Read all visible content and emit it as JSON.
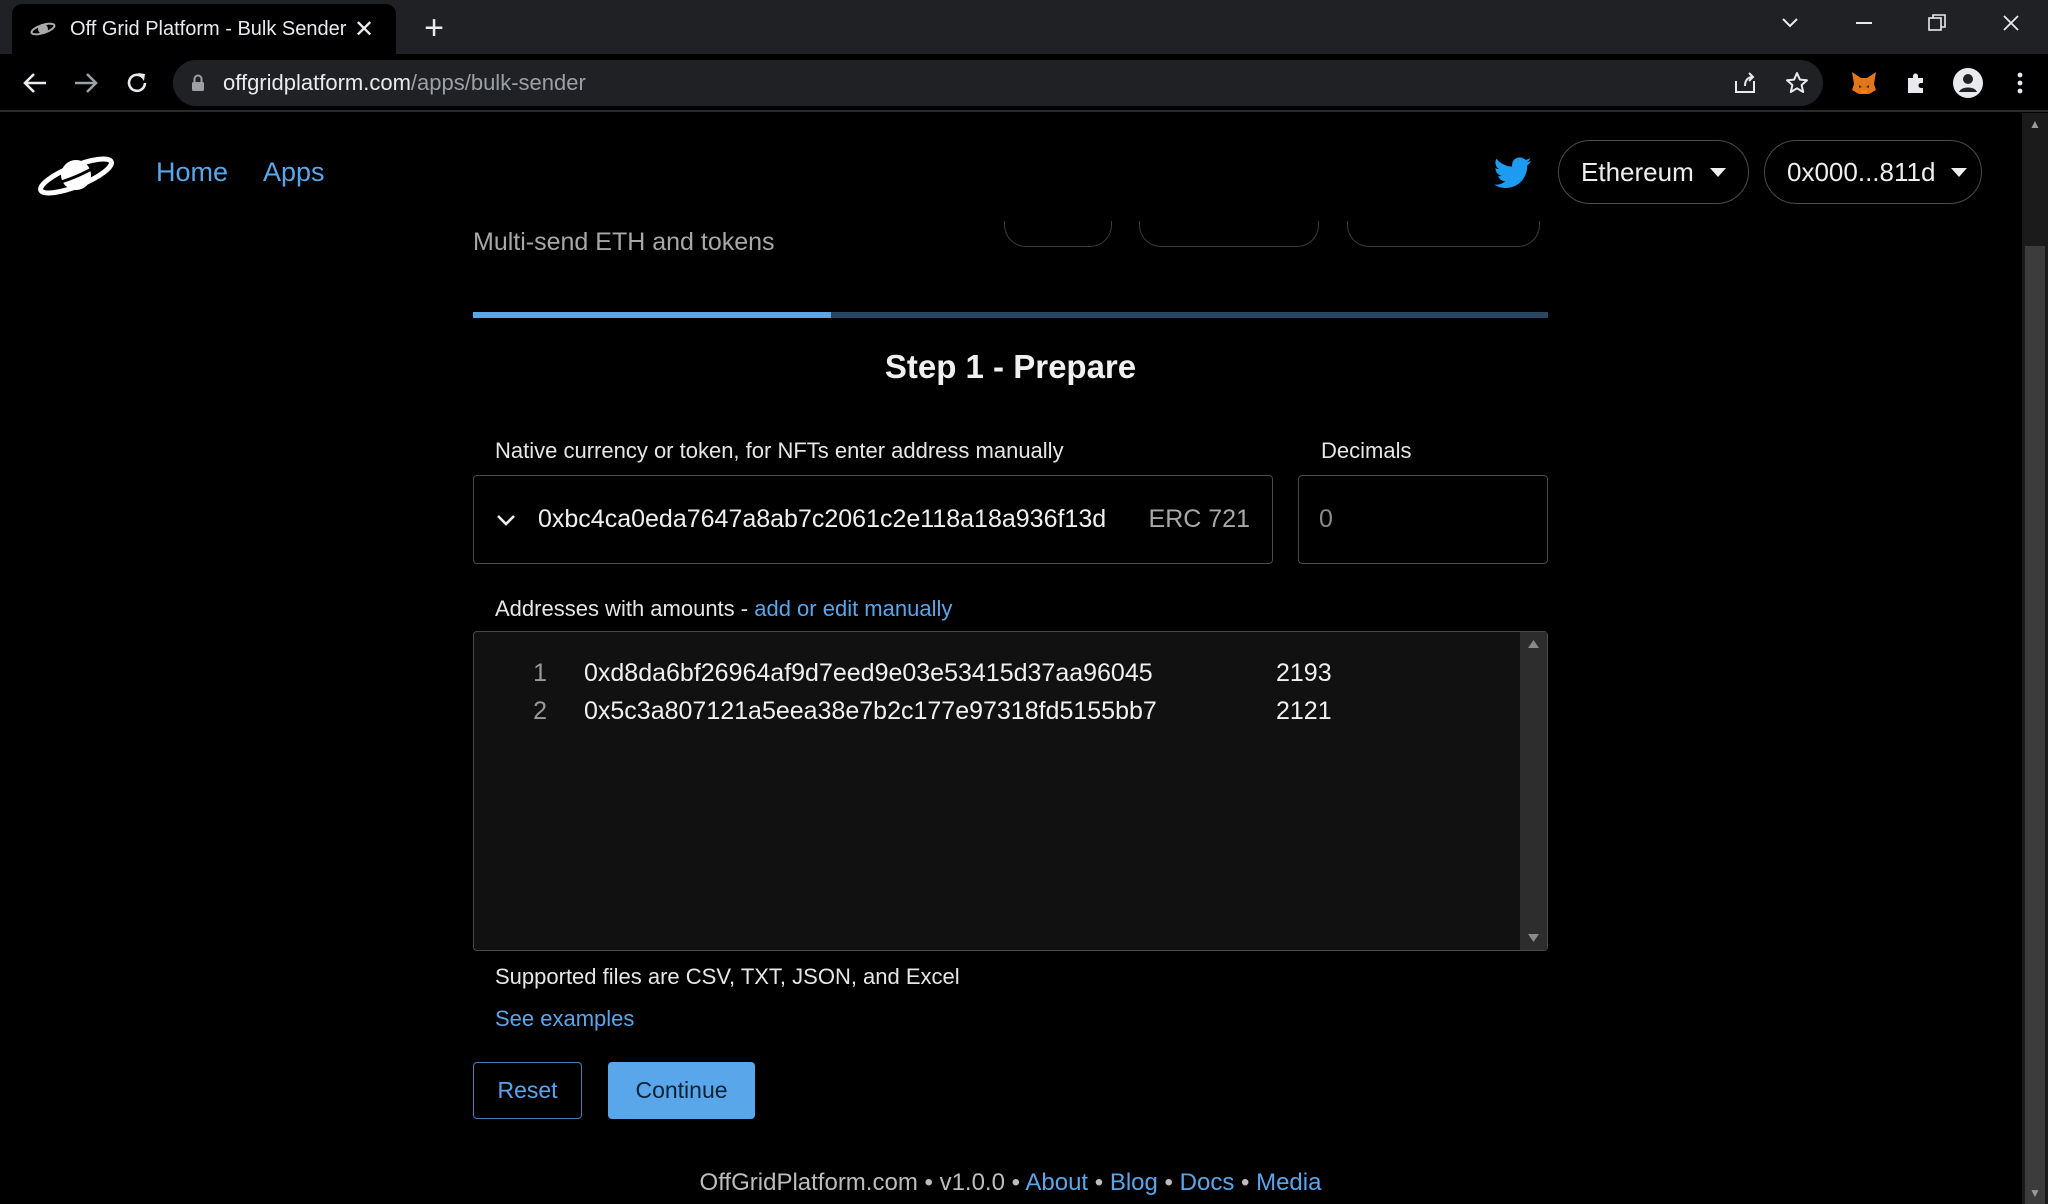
{
  "browser": {
    "tab_title": "Off Grid Platform - Bulk Sender",
    "url_host": "offgridplatform.com",
    "url_path": "/apps/bulk-sender"
  },
  "nav": {
    "home": "Home",
    "apps": "Apps",
    "network": "Ethereum",
    "account": "0x000...811d"
  },
  "page": {
    "subtitle": "Multi-send ETH and tokens",
    "progress_fraction": 0.333,
    "step_title": "Step 1 - Prepare"
  },
  "form": {
    "token_label": "Native currency or token, for NFTs enter address manually",
    "token_address": "0xbc4ca0eda7647a8ab7c2061c2e118a18a936f13d",
    "token_type": "ERC 721",
    "decimals_label": "Decimals",
    "decimals_value": "0",
    "addresses_label": "Addresses with amounts - ",
    "addresses_link": "add or edit manually",
    "rows": [
      {
        "line": "1",
        "address": "0xd8da6bf26964af9d7eed9e03e53415d37aa96045",
        "amount": "2193"
      },
      {
        "line": "2",
        "address": "0x5c3a807121a5eea38e7b2c177e97318fd5155bb7",
        "amount": "2121"
      }
    ],
    "supported_files": "Supported files are CSV, TXT, JSON, and Excel",
    "see_examples": "See examples",
    "reset": "Reset",
    "continue": "Continue"
  },
  "footer": {
    "site": "OffGridPlatform.com",
    "sep": " • ",
    "version": "v1.0.0",
    "about": "About",
    "blog": "Blog",
    "docs": "Docs",
    "media": "Media"
  },
  "colors": {
    "accent": "#5aa6ea",
    "background": "#000000",
    "twitter": "#1d9bf0"
  }
}
